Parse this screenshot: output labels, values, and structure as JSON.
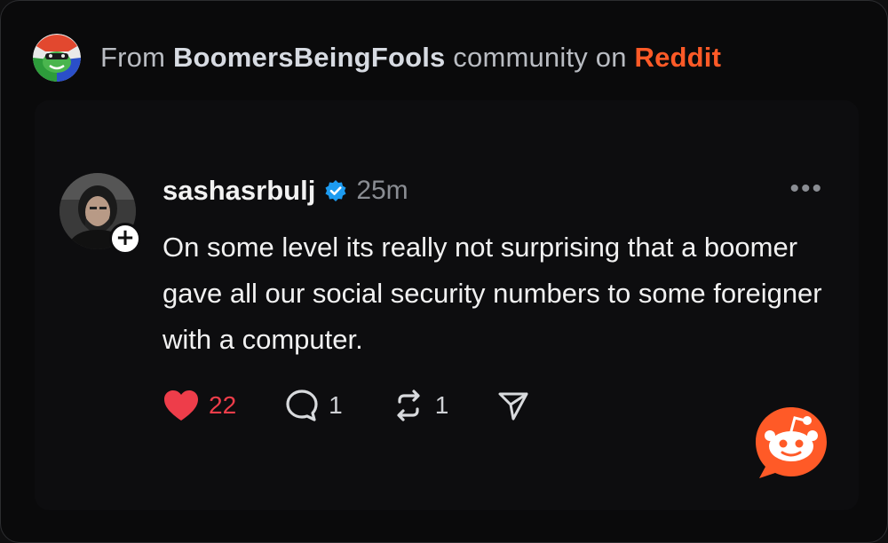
{
  "header": {
    "prefix": "From ",
    "community": "BoomersBeingFools",
    "middle": " community on ",
    "brand": "Reddit",
    "community_icon": "community-avatar-icon"
  },
  "post": {
    "username": "sashasrbulj",
    "verified_icon": "verified-badge-icon",
    "time": "25m",
    "more_label": "•••",
    "follow_label": "+",
    "text": "On some level its really not surprising that a boomer gave all our social security numbers to some foreigner with a computer.",
    "actions": {
      "like_count": "22",
      "reply_count": "1",
      "repost_count": "1"
    }
  },
  "colors": {
    "background": "#0a0a0b",
    "brand": "#ff5a27",
    "like": "#ee3d4a",
    "verified": "#1d9bf0",
    "muted": "#8a8d93"
  }
}
